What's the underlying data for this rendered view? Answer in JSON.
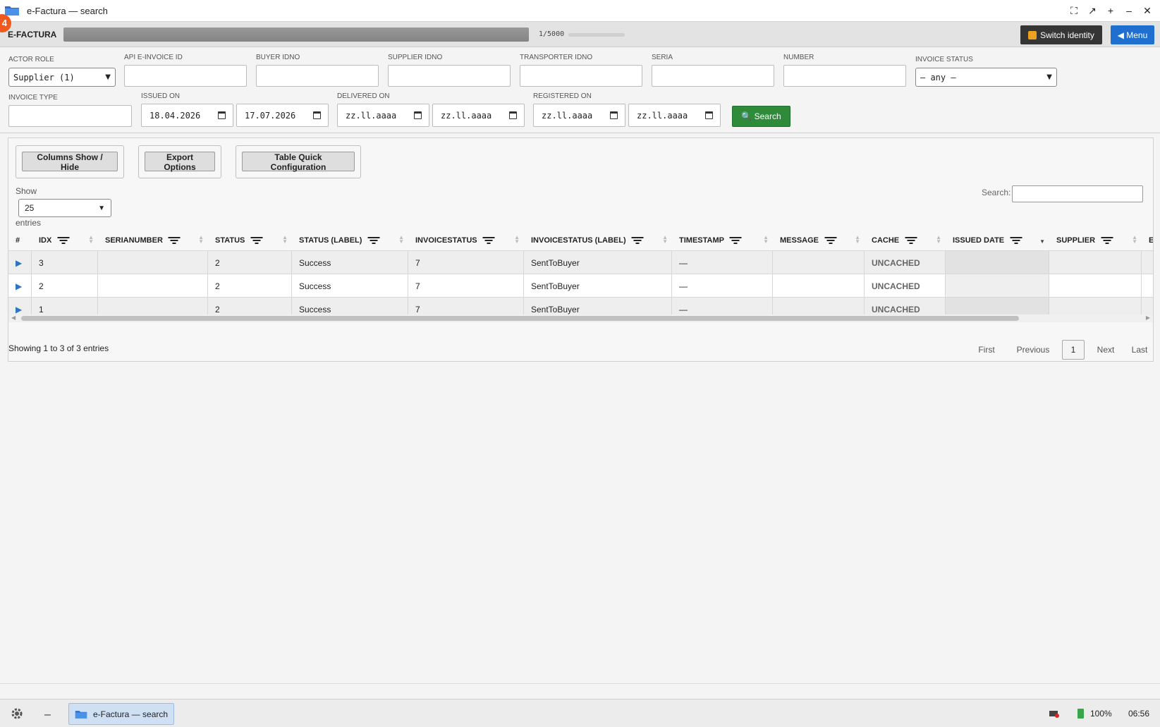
{
  "window": {
    "title": "e-Factura — search",
    "notification_count": "4"
  },
  "header": {
    "brand": "E-FACTURA",
    "progress_text": "1/5000",
    "switch_identity": "Switch identity",
    "menu": "◀ Menu"
  },
  "filters": {
    "actor_role": {
      "label": "ACTOR ROLE",
      "value": "Supplier (1)"
    },
    "api_einvoice_id": {
      "label": "API E-INVOICE ID",
      "value": ""
    },
    "buyer_idno": {
      "label": "BUYER IDNO",
      "value": ""
    },
    "supplier_idno": {
      "label": "SUPPLIER IDNO",
      "value": ""
    },
    "transporter_idno": {
      "label": "TRANSPORTER IDNO",
      "value": ""
    },
    "seria": {
      "label": "SERIA",
      "value": ""
    },
    "number": {
      "label": "NUMBER",
      "value": ""
    },
    "invoice_status": {
      "label": "INVOICE STATUS",
      "value": "— any —"
    },
    "invoice_type": {
      "label": "INVOICE TYPE",
      "value": ""
    },
    "issued_on": {
      "label": "ISSUED ON",
      "from": "18.04.2026",
      "to": "17.07.2026"
    },
    "delivered_on": {
      "label": "DELIVERED ON",
      "from": "zz.ll.aaaa",
      "to": "zz.ll.aaaa"
    },
    "registered_on": {
      "label": "REGISTERED ON",
      "from": "zz.ll.aaaa",
      "to": "zz.ll.aaaa"
    },
    "search_button": "Search"
  },
  "table_tools": {
    "columns_show_hide": "Columns Show / Hide",
    "export_options": "Export Options",
    "quick_config": "Table Quick Configuration",
    "show_label": "Show",
    "page_length": "25",
    "entries_label": "entries",
    "search_label": "Search:"
  },
  "table": {
    "columns": [
      "#",
      "IDX",
      "SERIANUMBER",
      "STATUS",
      "STATUS (LABEL)",
      "INVOICESTATUS",
      "INVOICESTATUS (LABEL)",
      "TIMESTAMP",
      "MESSAGE",
      "CACHE",
      "ISSUED DATE",
      "SUPPLIER",
      "E"
    ],
    "rows": [
      {
        "expand": "▶",
        "idx": "3",
        "serianumber": "",
        "status": "2",
        "status_label": "Success",
        "invoicestatus": "7",
        "invoicestatus_label": "SentToBuyer",
        "timestamp": "—",
        "message": "",
        "cache": "UNCACHED",
        "issued_date": "",
        "supplier": ""
      },
      {
        "expand": "▶",
        "idx": "2",
        "serianumber": "",
        "status": "2",
        "status_label": "Success",
        "invoicestatus": "7",
        "invoicestatus_label": "SentToBuyer",
        "timestamp": "—",
        "message": "",
        "cache": "UNCACHED",
        "issued_date": "",
        "supplier": ""
      },
      {
        "expand": "▶",
        "idx": "1",
        "serianumber": "",
        "status": "2",
        "status_label": "Success",
        "invoicestatus": "7",
        "invoicestatus_label": "SentToBuyer",
        "timestamp": "—",
        "message": "",
        "cache": "UNCACHED",
        "issued_date": "",
        "supplier": ""
      }
    ],
    "info": "Showing 1 to 3 of 3 entries",
    "pagination": {
      "first": "First",
      "previous": "Previous",
      "current": "1",
      "next": "Next",
      "last": "Last"
    }
  },
  "taskbar": {
    "task_label": "e-Factura — search",
    "battery": "100%",
    "time": "06:56"
  },
  "colors": {
    "accent_blue": "#1f6fd1",
    "search_green": "#2e8b3a",
    "badge_orange": "#f05a1e"
  }
}
